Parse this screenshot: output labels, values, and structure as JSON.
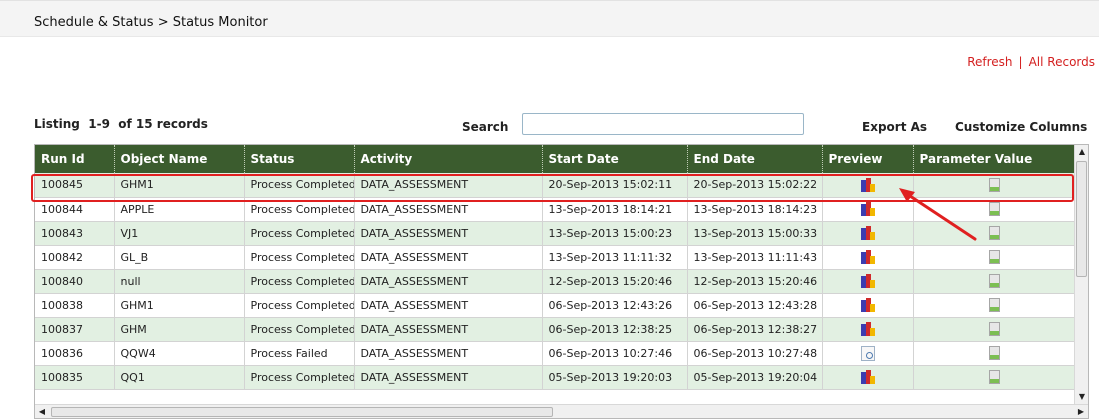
{
  "breadcrumb": "Schedule & Status > Status Monitor",
  "actions": {
    "refresh": "Refresh",
    "separator": "|",
    "all_records": "All Records"
  },
  "listing": "Listing  1-9  of 15 records",
  "search": {
    "label": "Search",
    "value": "",
    "placeholder": ""
  },
  "export_as": "Export As",
  "customize_columns": "Customize Columns",
  "columns": [
    "Run Id",
    "Object Name",
    "Status",
    "Activity",
    "Start Date",
    "End Date",
    "Preview",
    "Parameter Value"
  ],
  "rows": [
    {
      "run_id": "100845",
      "object": "GHM1",
      "status": "Process Completed",
      "activity": "DATA_ASSESSMENT",
      "start": "20-Sep-2013 15:02:11",
      "end": "20-Sep-2013 15:02:22",
      "preview_icon": "chart-preview-icon",
      "param_icon": "parameter-document-icon"
    },
    {
      "run_id": "100844",
      "object": "APPLE",
      "status": "Process Completed",
      "activity": "DATA_ASSESSMENT",
      "start": "13-Sep-2013 18:14:21",
      "end": "13-Sep-2013 18:14:23",
      "preview_icon": "chart-preview-icon",
      "param_icon": "parameter-document-icon"
    },
    {
      "run_id": "100843",
      "object": "VJ1",
      "status": "Process Completed",
      "activity": "DATA_ASSESSMENT",
      "start": "13-Sep-2013 15:00:23",
      "end": "13-Sep-2013 15:00:33",
      "preview_icon": "chart-preview-icon",
      "param_icon": "parameter-document-icon"
    },
    {
      "run_id": "100842",
      "object": "GL_B",
      "status": "Process Completed",
      "activity": "DATA_ASSESSMENT",
      "start": "13-Sep-2013 11:11:32",
      "end": "13-Sep-2013 11:11:43",
      "preview_icon": "chart-preview-icon",
      "param_icon": "parameter-document-icon"
    },
    {
      "run_id": "100840",
      "object": "null",
      "status": "Process Completed",
      "activity": "DATA_ASSESSMENT",
      "start": "12-Sep-2013 15:20:46",
      "end": "12-Sep-2013 15:20:46",
      "preview_icon": "chart-preview-icon",
      "param_icon": "parameter-document-icon"
    },
    {
      "run_id": "100838",
      "object": "GHM1",
      "status": "Process Completed",
      "activity": "DATA_ASSESSMENT",
      "start": "06-Sep-2013 12:43:26",
      "end": "06-Sep-2013 12:43:28",
      "preview_icon": "chart-preview-icon",
      "param_icon": "parameter-document-icon"
    },
    {
      "run_id": "100837",
      "object": "GHM",
      "status": "Process Completed",
      "activity": "DATA_ASSESSMENT",
      "start": "06-Sep-2013 12:38:25",
      "end": "06-Sep-2013 12:38:27",
      "preview_icon": "chart-preview-icon",
      "param_icon": "parameter-document-icon"
    },
    {
      "run_id": "100836",
      "object": "QQW4",
      "status": "Process Failed",
      "activity": "DATA_ASSESSMENT",
      "start": "06-Sep-2013 10:27:46",
      "end": "06-Sep-2013 10:27:48",
      "preview_icon": "document-search-icon",
      "param_icon": "parameter-document-icon"
    },
    {
      "run_id": "100835",
      "object": "QQ1",
      "status": "Process Completed",
      "activity": "DATA_ASSESSMENT",
      "start": "05-Sep-2013 19:20:03",
      "end": "05-Sep-2013 19:20:04",
      "preview_icon": "chart-preview-icon",
      "param_icon": "parameter-document-icon"
    }
  ],
  "highlight": {
    "color": "#e02020",
    "row_index": 0
  },
  "colors": {
    "header_bg": "#3b5c2e",
    "row_alt": "#e2f0e2",
    "link": "#d42020"
  }
}
